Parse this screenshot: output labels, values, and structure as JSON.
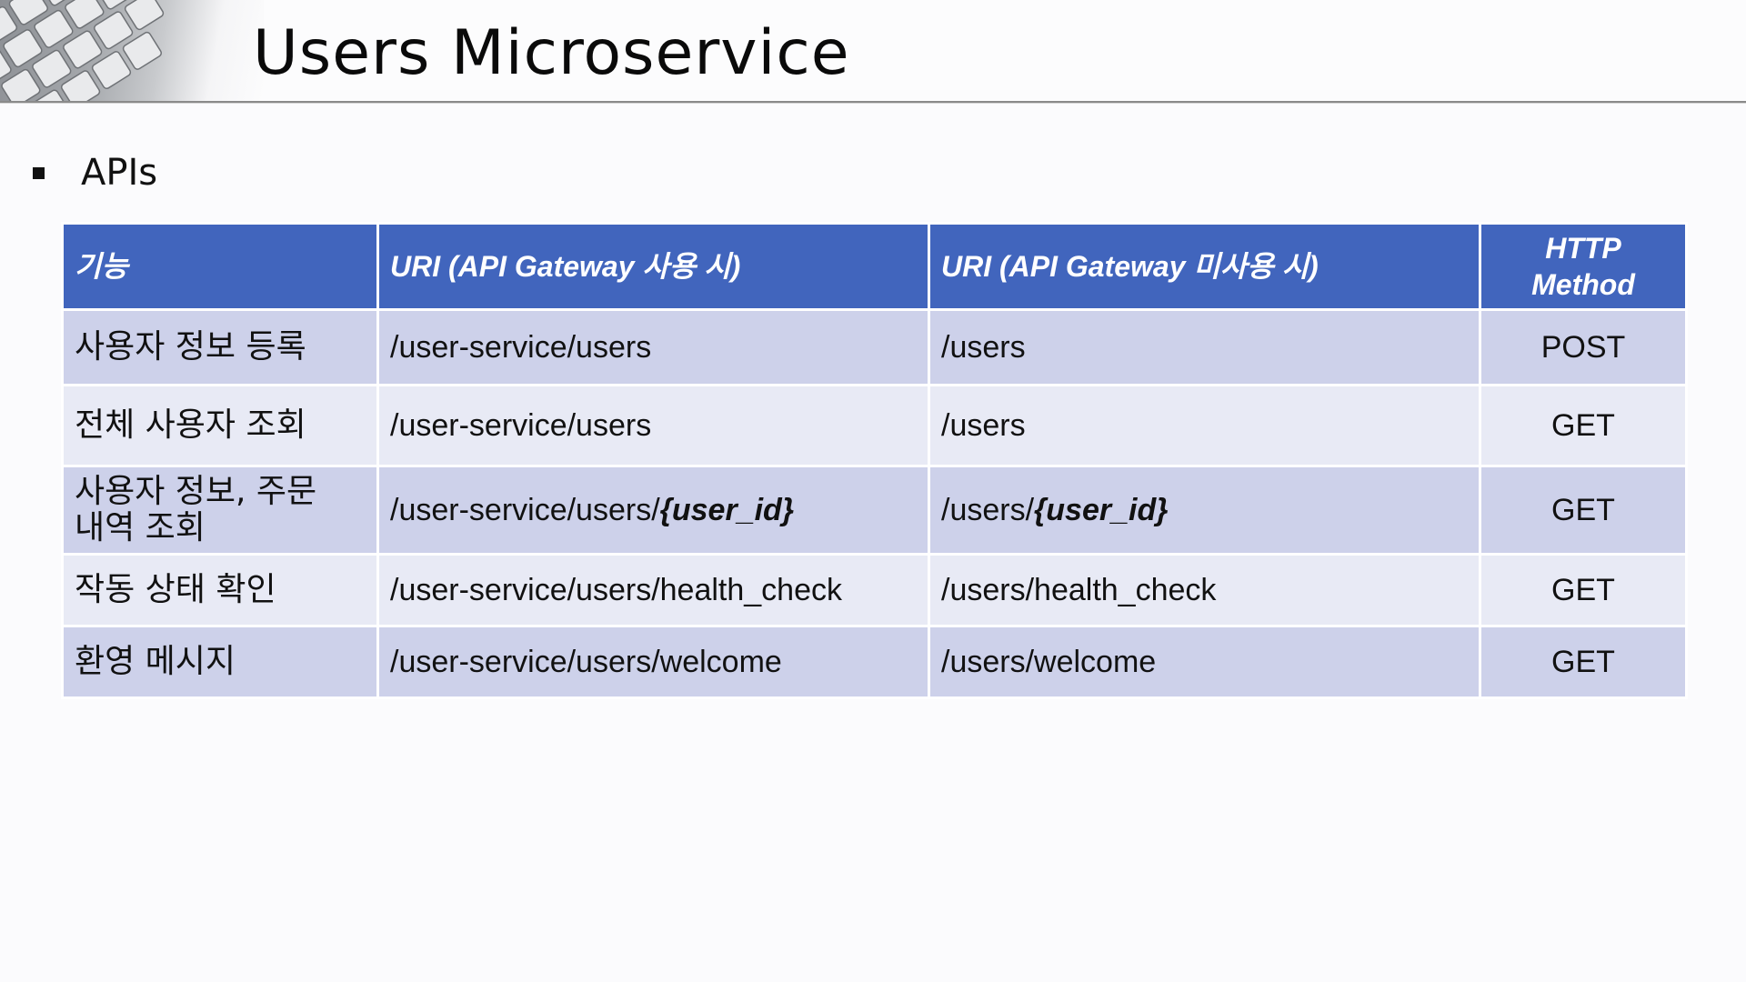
{
  "slide": {
    "title": "Users Microservice",
    "bullet": "APIs"
  },
  "table": {
    "headers": {
      "function": "기능",
      "uri_with_gateway": "URI (API Gateway 사용 시)",
      "uri_without_gateway": "URI (API Gateway 미사용 시)",
      "http_method_line1": "HTTP",
      "http_method_line2": "Method"
    },
    "rows": [
      {
        "function": "사용자 정보 등록",
        "uri_with_gateway": "/user-service/users",
        "uri_with_gateway_param": "",
        "uri_without_gateway": "/users",
        "uri_without_gateway_param": "",
        "method": "POST"
      },
      {
        "function": "전체 사용자 조회",
        "uri_with_gateway": "/user-service/users",
        "uri_with_gateway_param": "",
        "uri_without_gateway": "/users",
        "uri_without_gateway_param": "",
        "method": "GET"
      },
      {
        "function_line1": "사용자 정보, 주문",
        "function_line2": "내역 조회",
        "uri_with_gateway": "/user-service/users/",
        "uri_with_gateway_param": "{user_id}",
        "uri_without_gateway": "/users/",
        "uri_without_gateway_param": "{user_id}",
        "method": "GET"
      },
      {
        "function": "작동 상태 확인",
        "uri_with_gateway": "/user-service/users/health_check",
        "uri_with_gateway_param": "",
        "uri_without_gateway": "/users/health_check",
        "uri_without_gateway_param": "",
        "method": "GET"
      },
      {
        "function": "환영 메시지",
        "uri_with_gateway": "/user-service/users/welcome",
        "uri_with_gateway_param": "",
        "uri_without_gateway": "/users/welcome",
        "uri_without_gateway_param": "",
        "method": "GET"
      }
    ]
  },
  "colors": {
    "header_bg": "#4165bd",
    "row_odd_bg": "#cdd1ea",
    "row_even_bg": "#e8eaf5"
  }
}
